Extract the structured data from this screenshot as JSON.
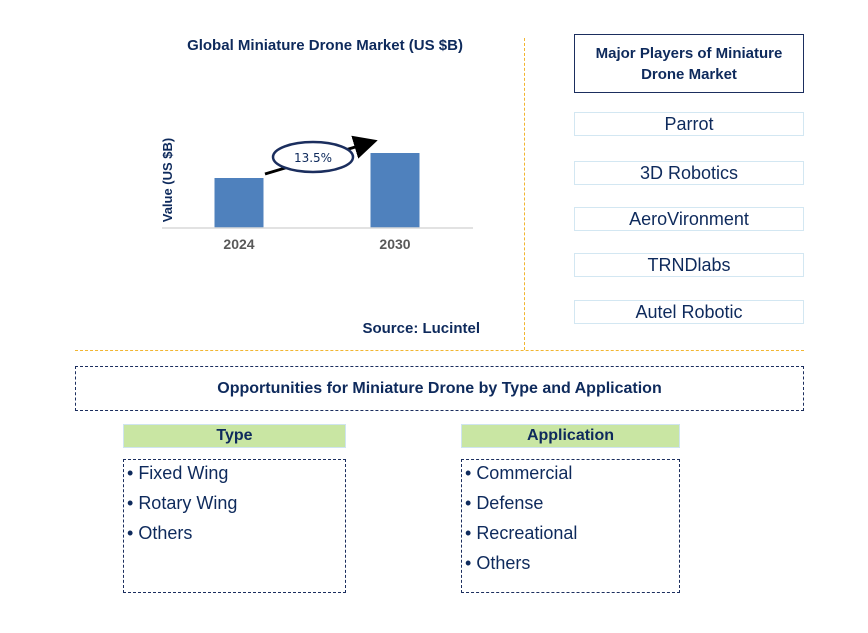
{
  "chart_data": {
    "type": "bar",
    "title": "Global Miniature Drone Market (US $B)",
    "xlabel": "",
    "ylabel": "Value (US $B)",
    "categories": [
      "2024",
      "2030"
    ],
    "values": [
      1.0,
      1.5
    ],
    "values_note": "relative bar heights; no numeric axis shown",
    "ylim": [
      0,
      1.8
    ],
    "grid": false,
    "annotation": {
      "label": "13.5%",
      "meaning": "CAGR arrow from 2024 to 2030"
    },
    "bar_color": "#4f81bd",
    "source": "Source: Lucintel"
  },
  "players": {
    "title": "Major Players of Miniature Drone Market",
    "items": [
      "Parrot",
      "3D Robotics",
      "AeroVironment",
      "TRNDlabs",
      "Autel Robotic"
    ]
  },
  "opportunities": {
    "title": "Opportunities for Miniature Drone by Type and Application",
    "type": {
      "header": "Type",
      "items": [
        "Fixed Wing",
        "Rotary Wing",
        "Others"
      ]
    },
    "application": {
      "header": "Application",
      "items": [
        "Commercial",
        "Defense",
        "Recreational",
        "Others"
      ]
    }
  },
  "colors": {
    "text": "#0e2a5c",
    "divider": "#f2b632",
    "header_green": "#c9e6a3",
    "bar": "#4f81bd"
  }
}
